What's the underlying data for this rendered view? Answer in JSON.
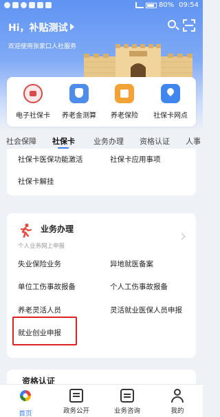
{
  "status_bar": {
    "battery": "80%",
    "time": "09:54"
  },
  "header": {
    "greeting": "Hi，补贴测试",
    "welcome": "欢迎使用张家口人社服务",
    "brand_color": "#5f93f3"
  },
  "quick_actions": [
    {
      "label": "电子社保卡",
      "icon": "e-social-card-icon"
    },
    {
      "label": "养老金测算",
      "icon": "pension-calc-icon"
    },
    {
      "label": "养老保险",
      "icon": "pension-insurance-icon"
    },
    {
      "label": "社保卡网点",
      "icon": "service-point-icon"
    }
  ],
  "tabs": [
    {
      "label": "社会保障"
    },
    {
      "label": "社保卡",
      "active": true
    },
    {
      "label": "业务办理"
    },
    {
      "label": "资格认证"
    },
    {
      "label": "人事"
    }
  ],
  "card1": {
    "items": [
      "社保卡医保功能激活",
      "社保卡应用事项",
      "社保卡解挂"
    ]
  },
  "card2": {
    "title": "业务办理",
    "subtitle": "个人业务网上申报",
    "items": [
      "失业保险业务",
      "异地就医备案",
      "单位工伤事故报备",
      "个人工伤事故报备",
      "养老灵活人员",
      "灵活就业医保人员申报",
      "就业创业申报"
    ],
    "highlight_color": "#e02020"
  },
  "card3": {
    "title": "资格认证"
  },
  "bottom_nav": [
    {
      "label": "首页",
      "active": true
    },
    {
      "label": "政务公开"
    },
    {
      "label": "业务咨询"
    },
    {
      "label": "我的"
    }
  ]
}
